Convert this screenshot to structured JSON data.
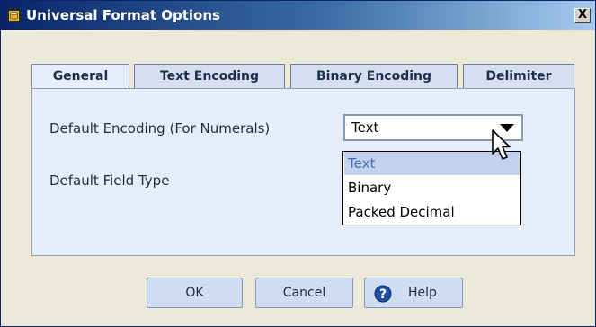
{
  "window": {
    "title": "Universal Format Options",
    "close_label": "X"
  },
  "tabs": [
    {
      "label": "General",
      "active": true
    },
    {
      "label": "Text Encoding",
      "active": false
    },
    {
      "label": "Binary Encoding",
      "active": false
    },
    {
      "label": "Delimiter",
      "active": false
    }
  ],
  "general": {
    "default_encoding_label": "Default Encoding (For Numerals)",
    "default_field_type_label": "Default Field Type",
    "encoding_select": {
      "value": "Text",
      "options": [
        "Text",
        "Binary",
        "Packed Decimal"
      ],
      "highlighted": "Text"
    }
  },
  "buttons": {
    "ok": "OK",
    "cancel": "Cancel",
    "help": "Help"
  },
  "icons": {
    "app": "app-icon",
    "close": "close-icon",
    "dropdown": "chevron-down-icon",
    "cursor": "mouse-pointer-icon",
    "help": "help-icon"
  },
  "colors": {
    "titlebar_start": "#0a246a",
    "titlebar_end": "#a6caf0",
    "panel": "#e6edf9",
    "selected_option": "#c3d2ef"
  }
}
